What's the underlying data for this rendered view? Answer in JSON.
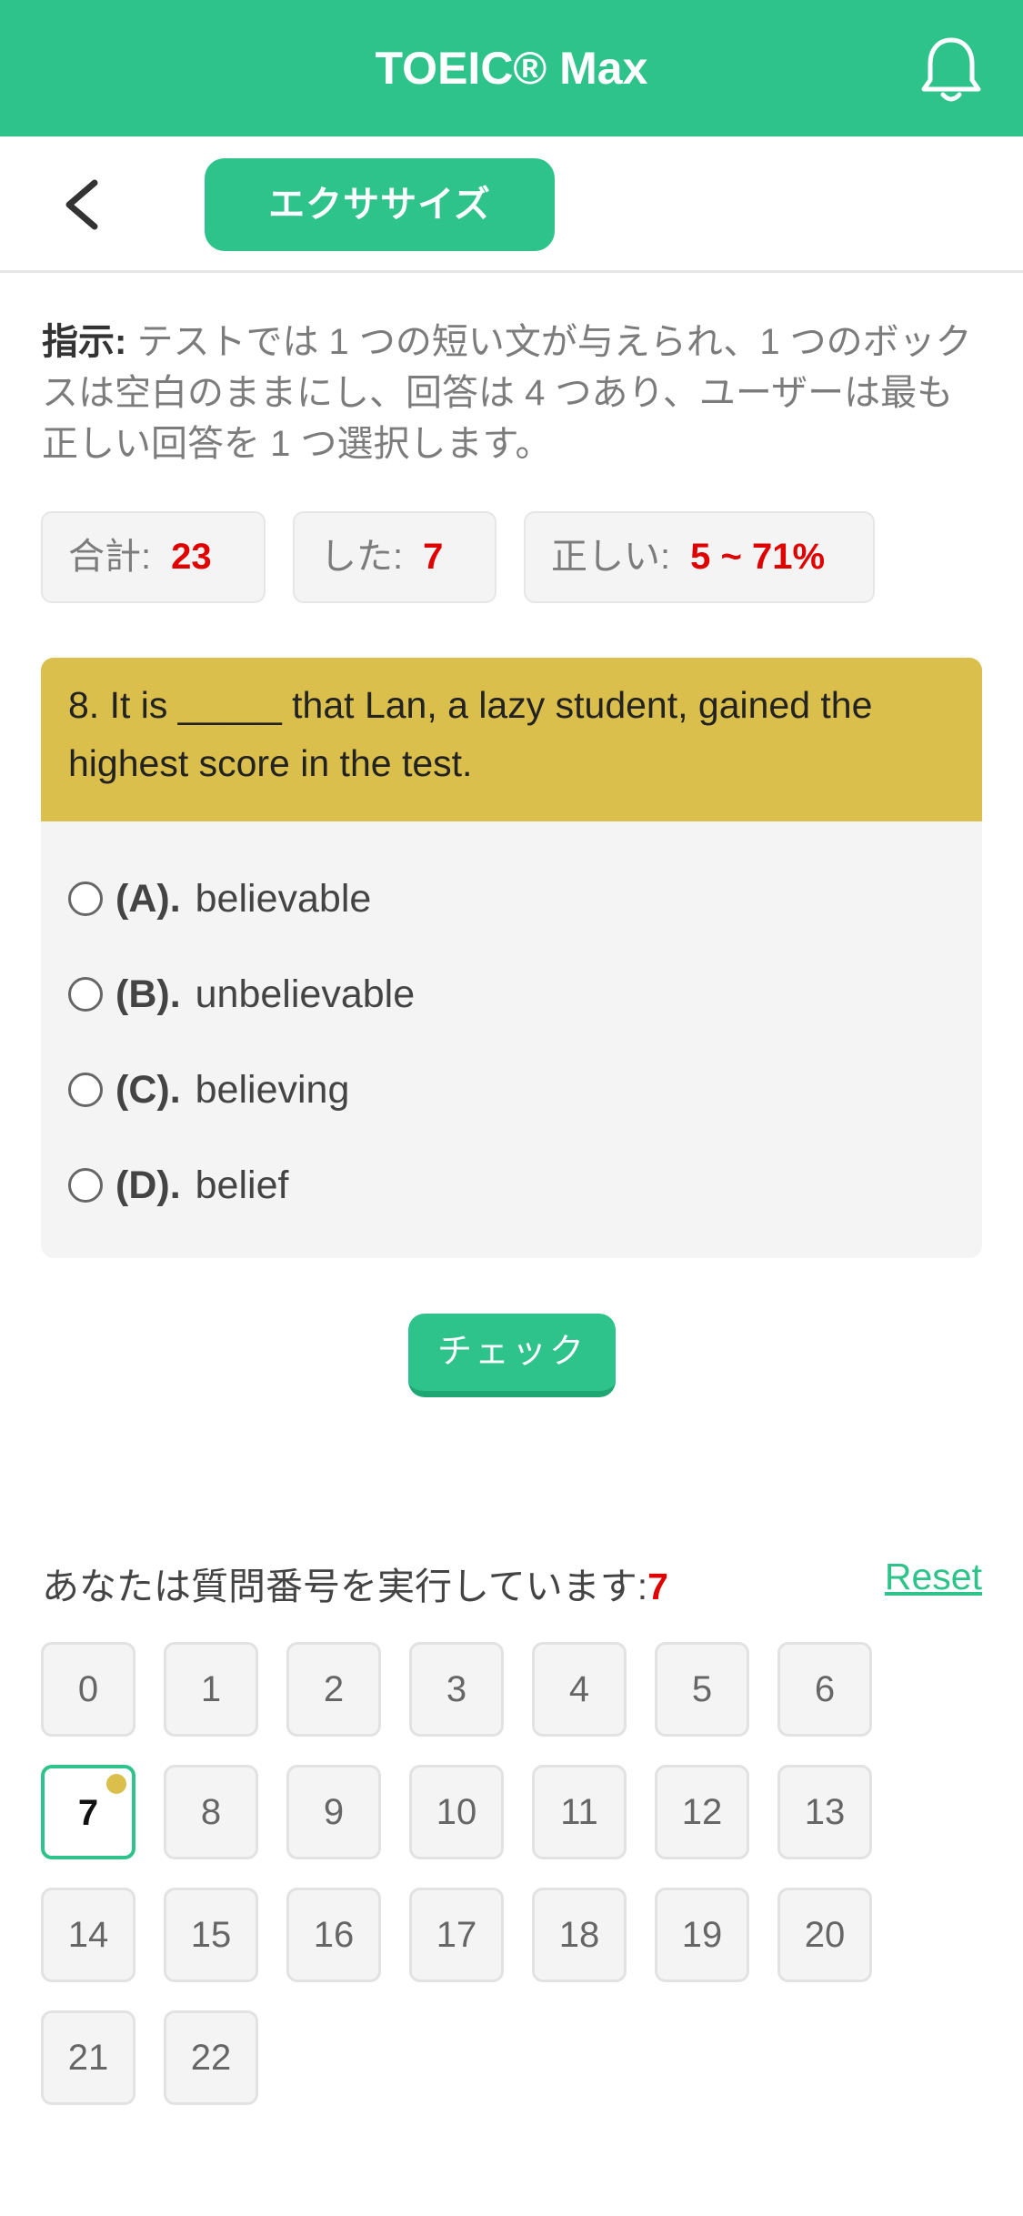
{
  "header": {
    "title": "TOEIC® Max",
    "bell_icon": "bell-icon"
  },
  "subbar": {
    "back_icon": "chevron-left-icon",
    "tab_label": "エクササイズ"
  },
  "instructions": {
    "label": "指示:",
    "text": " テストでは 1 つの短い文が与えられ、1 つのボックスは空白のままにし、回答は 4 つあり、ユーザーは最も正しい回答を 1 つ選択します。"
  },
  "stats": {
    "total_label": "合計:",
    "total_value": "23",
    "done_label": "した:",
    "done_value": "7",
    "correct_label": "正しい:",
    "correct_value": "5 ~ 71%"
  },
  "question": {
    "text": "8. It is _____ that Lan, a lazy student, gained the highest score in the test.",
    "options": [
      {
        "label": "(A).",
        "text": "believable"
      },
      {
        "label": "(B).",
        "text": "unbelievable"
      },
      {
        "label": "(C).",
        "text": "believing"
      },
      {
        "label": "(D).",
        "text": "belief"
      }
    ]
  },
  "check_button": "チェック",
  "progress": {
    "label": "あなたは質問番号を実行しています:",
    "current": "7",
    "reset": "Reset"
  },
  "question_numbers": [
    "0",
    "1",
    "2",
    "3",
    "4",
    "5",
    "6",
    "7",
    "8",
    "9",
    "10",
    "11",
    "12",
    "13",
    "14",
    "15",
    "16",
    "17",
    "18",
    "19",
    "20",
    "21",
    "22"
  ],
  "current_index": 7,
  "colors": {
    "primary": "#2dc38a",
    "question_header": "#dbbf4c",
    "accent_red": "#e00000"
  }
}
